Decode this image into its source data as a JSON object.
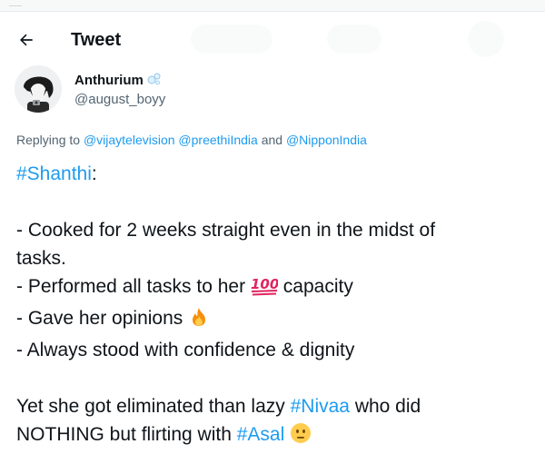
{
  "header": {
    "title": "Tweet"
  },
  "author": {
    "display_name": "Anthurium",
    "handle": "@august_boyy",
    "badge_icon": "soap-bubbles-icon"
  },
  "reply": {
    "prefix": "Replying to",
    "mentions": [
      "@vijaytelevision",
      "@preethiIndia",
      "@NipponIndia"
    ],
    "separator": "and"
  },
  "tweet": {
    "hashtag_heading": "#Shanthi",
    "heading_suffix": ":",
    "bullet_1_line_1": "- Cooked for 2 weeks straight even in the midst of",
    "bullet_1_line_2": "tasks.",
    "bullet_2_prefix": "- Performed all tasks to her",
    "bullet_2_emoji": "hundred-points-emoji",
    "bullet_2_suffix": "capacity",
    "bullet_3_text": "- Gave her opinions",
    "bullet_3_emoji": "fire-emoji",
    "bullet_4_text": "- Always stood with confidence & dignity",
    "closing_line_1_text": "Yet she got eliminated than lazy",
    "closing_hashtag_1": "#Nivaa",
    "closing_line_1_suffix": "who did",
    "closing_line_2_text": "NOTHING but flirting with",
    "closing_hashtag_2": "#Asal",
    "closing_emoji": "neutral-face-emoji"
  },
  "colors": {
    "link": "#1d9bf0",
    "text": "#0f1419",
    "secondary": "#536471"
  }
}
